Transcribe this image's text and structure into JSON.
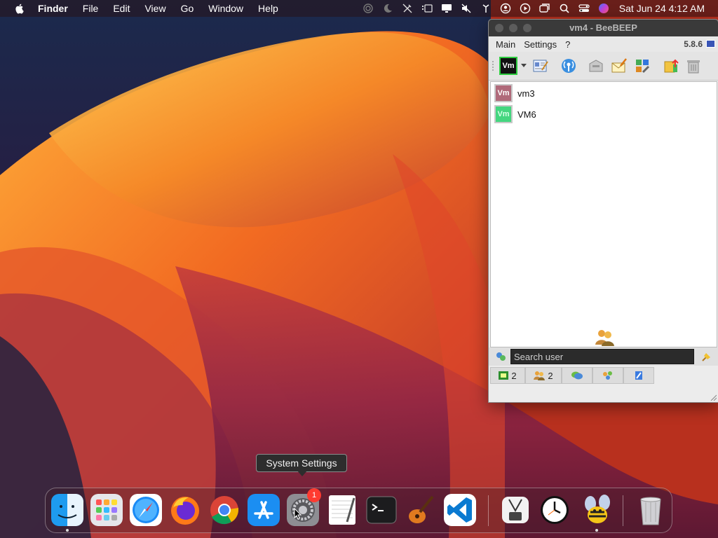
{
  "menubar": {
    "app_name": "Finder",
    "items": [
      "File",
      "Edit",
      "View",
      "Go",
      "Window",
      "Help"
    ],
    "clock": "Sat Jun 24  4:12 AM",
    "status_icons": [
      "airdrop-icon",
      "moon-icon",
      "pen-off-icon",
      "stage-manager-icon",
      "display-icon",
      "mute-icon",
      "wifi-icon",
      "user-icon",
      "play-icon",
      "screens-icon",
      "search-icon",
      "control-center-icon",
      "siri-icon"
    ]
  },
  "beebeep": {
    "title": "vm4 - BeeBEEP",
    "version": "5.8.6",
    "menu": [
      "Main",
      "Settings",
      "?"
    ],
    "status_button_label": "Vm",
    "users": [
      {
        "avatar": "Vm",
        "name": "vm3"
      },
      {
        "avatar": "Vm",
        "name": "VM6"
      }
    ],
    "search_placeholder": "Search user",
    "tabs": [
      {
        "icon": "users-online-icon",
        "count": "2"
      },
      {
        "icon": "users-group-icon",
        "count": "2"
      },
      {
        "icon": "chat-icon",
        "count": ""
      },
      {
        "icon": "groups-icon",
        "count": ""
      },
      {
        "icon": "files-icon",
        "count": ""
      }
    ]
  },
  "tooltip": {
    "text": "System Settings"
  },
  "dock": {
    "items": [
      "Finder",
      "Launchpad",
      "Safari",
      "Firefox",
      "Google Chrome",
      "App Store",
      "System Settings",
      "TextEdit",
      "Terminal",
      "GarageBand",
      "Visual Studio Code",
      "System Information",
      "Clock",
      "BeeBEEP",
      "Trash"
    ],
    "badge": "1"
  },
  "colors": {
    "accent_orange": "#f28a1e",
    "wall_dark": "#1a1530",
    "badge_red": "#ff3b30"
  }
}
